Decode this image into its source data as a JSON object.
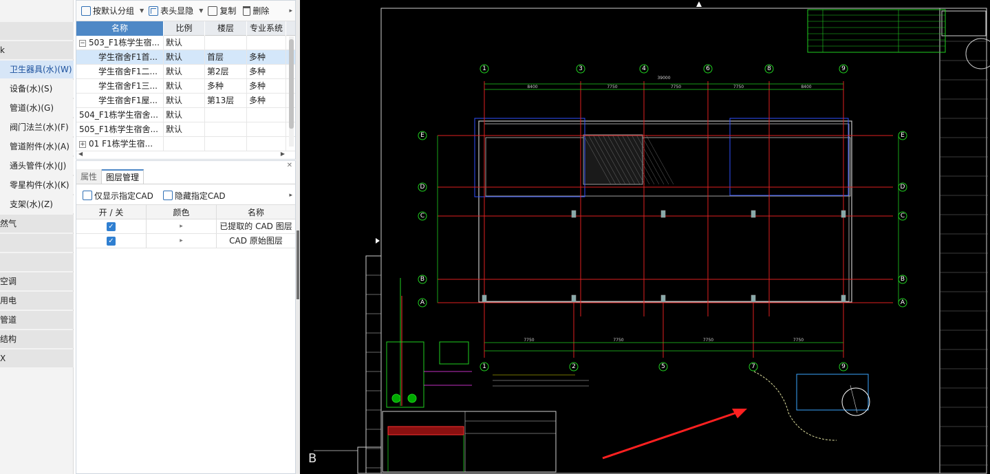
{
  "categories": [
    {
      "label": "",
      "type": "group"
    },
    {
      "label": "k",
      "type": "group"
    },
    {
      "label": "卫生器具(水)(W)",
      "type": "sub",
      "selected": true
    },
    {
      "label": "设备(水)(S)",
      "type": "sub"
    },
    {
      "label": "管道(水)(G)",
      "type": "sub"
    },
    {
      "label": "阀门法兰(水)(F)",
      "type": "sub"
    },
    {
      "label": "管道附件(水)(A)",
      "type": "sub"
    },
    {
      "label": "通头管件(水)(J)",
      "type": "sub"
    },
    {
      "label": "零星构件(水)(K)",
      "type": "sub"
    },
    {
      "label": "支架(水)(Z)",
      "type": "sub"
    },
    {
      "label": "然气",
      "type": "group"
    },
    {
      "label": "",
      "type": "group"
    },
    {
      "label": "",
      "type": "group"
    },
    {
      "label": "空调",
      "type": "group"
    },
    {
      "label": "用电",
      "type": "group"
    },
    {
      "label": "管道",
      "type": "group"
    },
    {
      "label": "结构",
      "type": "group"
    },
    {
      "label": "X",
      "type": "group"
    }
  ],
  "toolbar": {
    "group_label": "按默认分组",
    "header_label": "表头显隐",
    "copy_label": "复制",
    "delete_label": "删除"
  },
  "table": {
    "headers": {
      "name": "名称",
      "ratio": "比例",
      "floor": "楼层",
      "system": "专业系统"
    },
    "rows": [
      {
        "expander": "−",
        "name": "503_F1栋学生宿...",
        "ratio": "默认",
        "floor": "",
        "system": "",
        "indent": 0
      },
      {
        "expander": "",
        "name": "学生宿舍F1首...",
        "ratio": "默认",
        "floor": "首层",
        "system": "多种",
        "indent": 1,
        "selected": true
      },
      {
        "expander": "",
        "name": "学生宿舍F1二...",
        "ratio": "默认",
        "floor": "第2层",
        "system": "多种",
        "indent": 1
      },
      {
        "expander": "",
        "name": "学生宿舍F1三...",
        "ratio": "默认",
        "floor": "多种",
        "system": "多种",
        "indent": 1
      },
      {
        "expander": "",
        "name": "学生宿舍F1屋...",
        "ratio": "默认",
        "floor": "第13层",
        "system": "多种",
        "indent": 1
      },
      {
        "expander": "",
        "name": "504_F1栋学生宿舍...",
        "ratio": "默认",
        "floor": "",
        "system": "",
        "indent": 0
      },
      {
        "expander": "",
        "name": "505_F1栋学生宿舍...",
        "ratio": "默认",
        "floor": "",
        "system": "",
        "indent": 0
      },
      {
        "expander": "+",
        "name": "01 F1栋学生宿...",
        "ratio": "",
        "floor": "",
        "system": "",
        "indent": 0
      }
    ]
  },
  "lower_panel": {
    "tabs": [
      "属性",
      "图层管理"
    ],
    "active_tab": "图层管理",
    "show_only_label": "仅显示指定CAD",
    "hide_label": "隐藏指定CAD",
    "layer_headers": {
      "toggle": "开 / 关",
      "color": "颜色",
      "name": "名称"
    },
    "layers": [
      {
        "on": true,
        "name": "已提取的 CAD 图层"
      },
      {
        "on": true,
        "name": "CAD 原始图层"
      }
    ]
  },
  "cad": {
    "grid_top": [
      "1",
      "3",
      "4",
      "6",
      "8",
      "9"
    ],
    "grid_bottom": [
      "1",
      "2",
      "5",
      "7",
      "9"
    ],
    "grid_rows": [
      "E",
      "D",
      "C",
      "B",
      "A"
    ],
    "dims_top": [
      "8400",
      "7750",
      "7750",
      "7750",
      "8400"
    ],
    "dims_bottom": [
      "7750",
      "7750",
      "7750",
      "7750"
    ],
    "total_dim": "39000",
    "sheet_letter": "B",
    "colors": {
      "grid": "#e02020",
      "green": "#20d020",
      "wall": "#c8c8c8",
      "blue": "#3050ff",
      "yellow": "#e8e800",
      "arrow": "#ff2020"
    }
  }
}
